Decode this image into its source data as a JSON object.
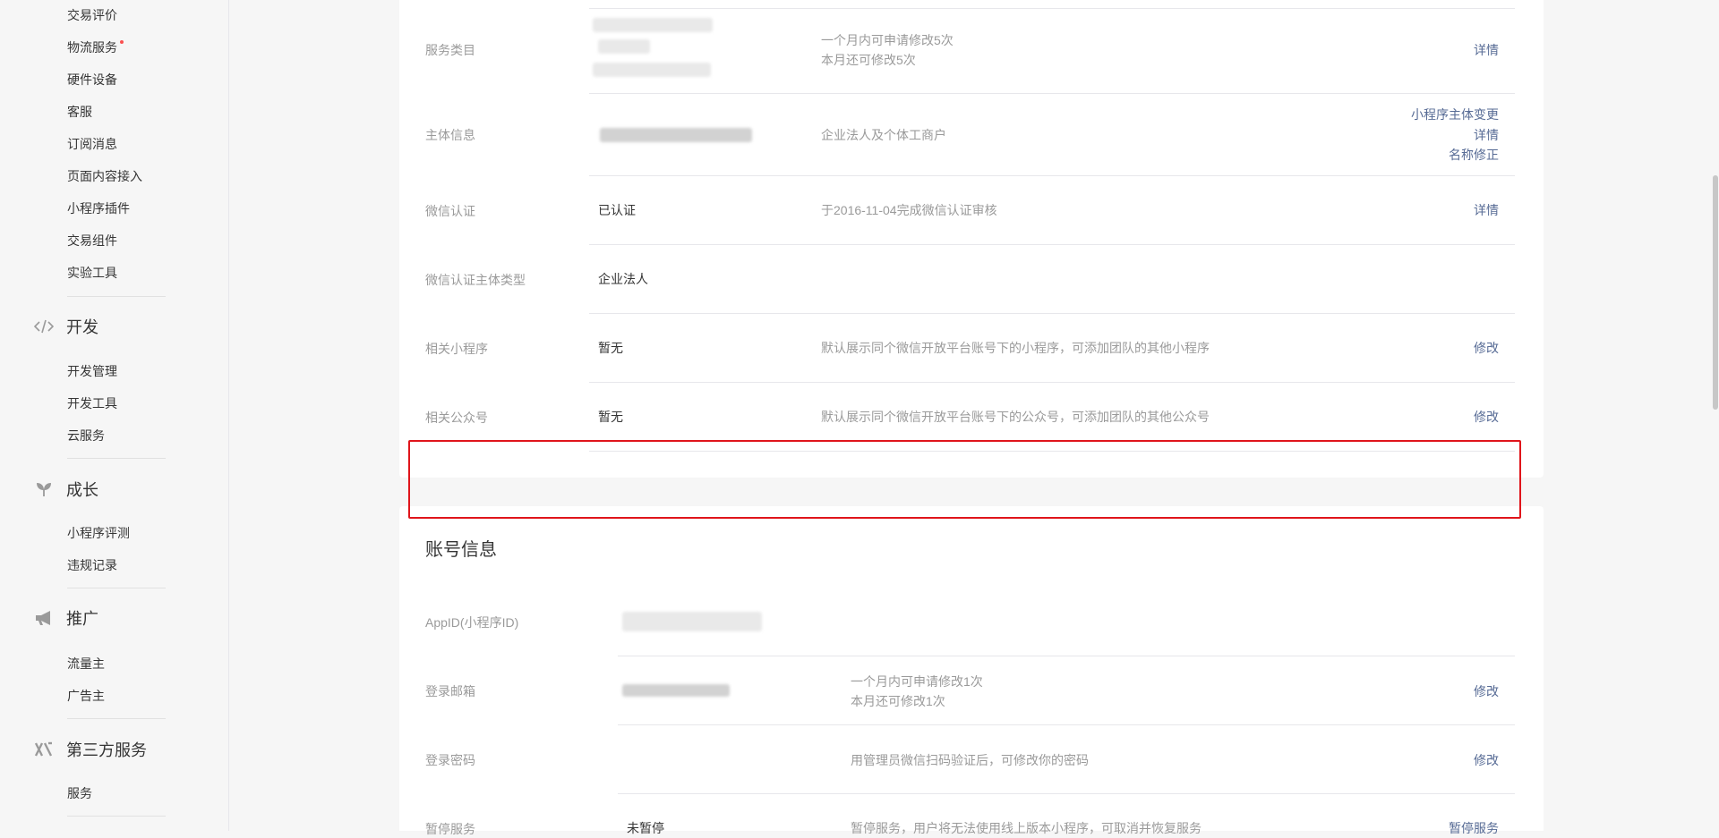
{
  "sidebar": {
    "items_top": [
      {
        "label": "交易评价"
      },
      {
        "label": "物流服务",
        "dot": true
      },
      {
        "label": "硬件设备"
      },
      {
        "label": "客服"
      },
      {
        "label": "订阅消息"
      },
      {
        "label": "页面内容接入"
      },
      {
        "label": "小程序插件"
      },
      {
        "label": "交易组件"
      },
      {
        "label": "实验工具"
      }
    ],
    "groups": {
      "dev": {
        "label": "开发",
        "icon": "code-icon",
        "items": [
          "开发管理",
          "开发工具",
          "云服务"
        ]
      },
      "growth": {
        "label": "成长",
        "icon": "sprout-icon",
        "items": [
          "小程序评测",
          "违规记录"
        ]
      },
      "promo": {
        "label": "推广",
        "icon": "megaphone-icon",
        "items": [
          "流量主",
          "广告主"
        ]
      },
      "thirdparty": {
        "label": "第三方服务",
        "icon": "third-party-icon",
        "items": [
          "服务"
        ]
      }
    }
  },
  "basic_info": {
    "rows": {
      "service_category": {
        "label": "服务类目",
        "desc1": "一个月内可申请修改5次",
        "desc2": "本月还可修改5次",
        "action": "详情"
      },
      "entity_info": {
        "label": "主体信息",
        "desc": "企业法人及个体工商户",
        "actions": [
          "小程序主体变更",
          "详情",
          "名称修正"
        ]
      },
      "wechat_cert": {
        "label": "微信认证",
        "value": "已认证",
        "desc": "于2016-11-04完成微信认证审核",
        "action": "详情"
      },
      "cert_type": {
        "label": "微信认证主体类型",
        "value": "企业法人"
      },
      "related_mp": {
        "label": "相关小程序",
        "value": "暂无",
        "desc": "默认展示同个微信开放平台账号下的小程序，可添加团队的其他小程序",
        "action": "修改"
      },
      "related_oa": {
        "label": "相关公众号",
        "value": "暂无",
        "desc": "默认展示同个微信开放平台账号下的公众号，可添加团队的其他公众号",
        "action": "修改"
      }
    }
  },
  "account_info": {
    "title": "账号信息",
    "rows": {
      "appid": {
        "label": "AppID(小程序ID)"
      },
      "email": {
        "label": "登录邮箱",
        "desc1": "一个月内可申请修改1次",
        "desc2": "本月还可修改1次",
        "action": "修改"
      },
      "password": {
        "label": "登录密码",
        "desc": "用管理员微信扫码验证后，可修改你的密码",
        "action": "修改"
      },
      "pause": {
        "label": "暂停服务",
        "value": "未暂停",
        "desc": "暂停服务，用户将无法使用线上版本小程序，可取消并恢复服务",
        "action": "暂停服务"
      }
    }
  },
  "colors": {
    "accent": "#576b95",
    "highlight": "#e0151b"
  }
}
